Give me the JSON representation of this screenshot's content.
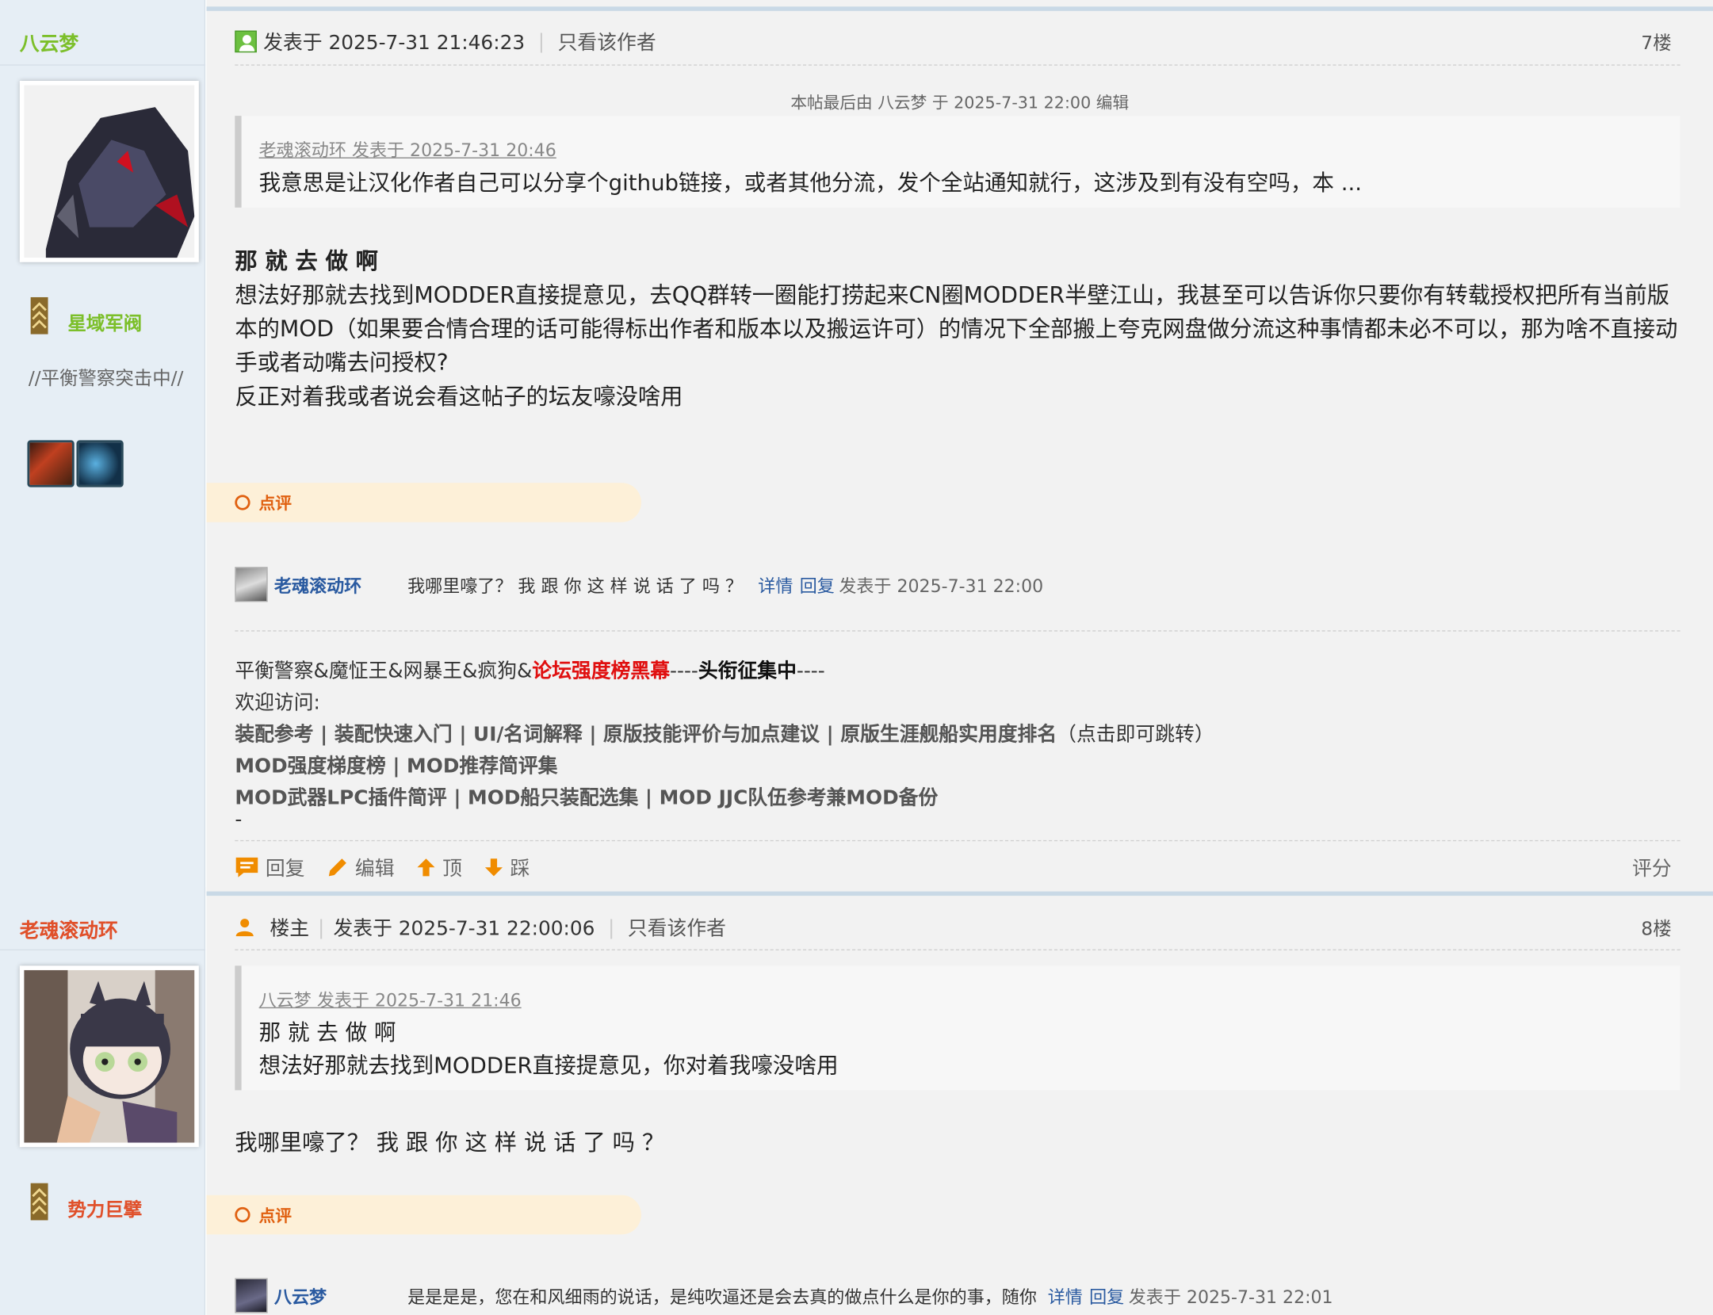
{
  "post7": {
    "username": "八云梦",
    "rank": "星域军阀",
    "side_signature": "//平衡警察突击中//",
    "posted_at": "发表于 2025-7-31 21:46:23",
    "only_author": "只看该作者",
    "floor": "7楼",
    "edit_note": "本帖最后由 八云梦 于 2025-7-31 22:00 编辑",
    "quote_head": "老魂滚动环 发表于 2025-7-31 20:46",
    "quote_body": "我意思是让汉化作者自己可以分享个github链接，或者其他分流，发个全站通知就行，这涉及到有没有空吗，本 ...",
    "body_bold": "那 就 去 做 啊",
    "body_para": "想法好那就去找到MODDER直接提意见，去QQ群转一圈能打捞起来CN圈MODDER半壁江山，我甚至可以告诉你只要你有转载授权把所有当前版本的MOD（如果要合情合理的话可能得标出作者和版本以及搬运许可）的情况下全部搬上夸克网盘做分流这种事情都未必不可以，那为啥不直接动手或者动嘴去问授权?",
    "body_para2": "反正对着我或者说会看这帖子的坛友嚎没啥用",
    "comment_tab": "点评",
    "comment": {
      "user": "老魂滚动环",
      "text": "我哪里嚎了？ 我 跟 你 这 样 说 话 了 吗 ？",
      "detail": "详情",
      "reply": "回复",
      "date": "发表于 2025-7-31 22:00"
    },
    "sig_line1_a": "平衡警察&魔怔王&网暴王&疯狗&",
    "sig_line1_red": "论坛强度榜黑幕",
    "sig_line1_b": "----",
    "sig_line1_bold": "头衔征集中",
    "sig_line1_c": "----",
    "sig_line2": "欢迎访问:",
    "sig_line3": "装配参考 | 装配快速入门 | UI/名词解释 | 原版技能评价与加点建议 | 原版生涯舰船实用度排名",
    "sig_line3_tail": "（点击即可跳转）",
    "sig_line4": "MOD强度梯度榜 | MOD推荐简评集",
    "sig_line5": "MOD武器LPC插件简评 | MOD船只装配选集 | MOD JJC队伍参考兼MOD备份",
    "sig_line6": "-",
    "actions": {
      "reply": "回复",
      "edit": "编辑",
      "up": "顶",
      "down": "踩",
      "rate": "评分"
    }
  },
  "post8": {
    "username": "老魂滚动环",
    "rank": "势力巨擘",
    "role": "楼主",
    "posted_at": "发表于 2025-7-31 22:00:06",
    "only_author": "只看该作者",
    "floor": "8楼",
    "quote_head": "八云梦 发表于 2025-7-31 21:46",
    "quote_body1": "那 就 去 做 啊",
    "quote_body2": "想法好那就去找到MODDER直接提意见，你对着我嚎没啥用",
    "body": "我哪里嚎了？ 我 跟 你 这 样 说 话 了 吗 ？",
    "comment_tab": "点评",
    "comment": {
      "user": "八云梦",
      "text": "是是是是，您在和风细雨的说话，是纯吹逼还是会去真的做点什么是你的事，随你",
      "detail": "详情",
      "reply": "回复",
      "date": "发表于 2025-7-31 22:01"
    }
  },
  "colors": {
    "user7": "#7cbf2a",
    "user8": "#e0502a",
    "link": "#2a5aa0",
    "accent": "#f08c00"
  }
}
